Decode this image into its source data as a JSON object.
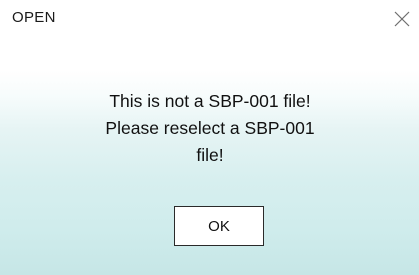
{
  "dialog": {
    "title": "OPEN",
    "close_icon": "close-icon",
    "message_lines": [
      "This is not a SBP-001 file!",
      "Please reselect a SBP-001",
      "file!"
    ],
    "ok_label": "OK"
  }
}
